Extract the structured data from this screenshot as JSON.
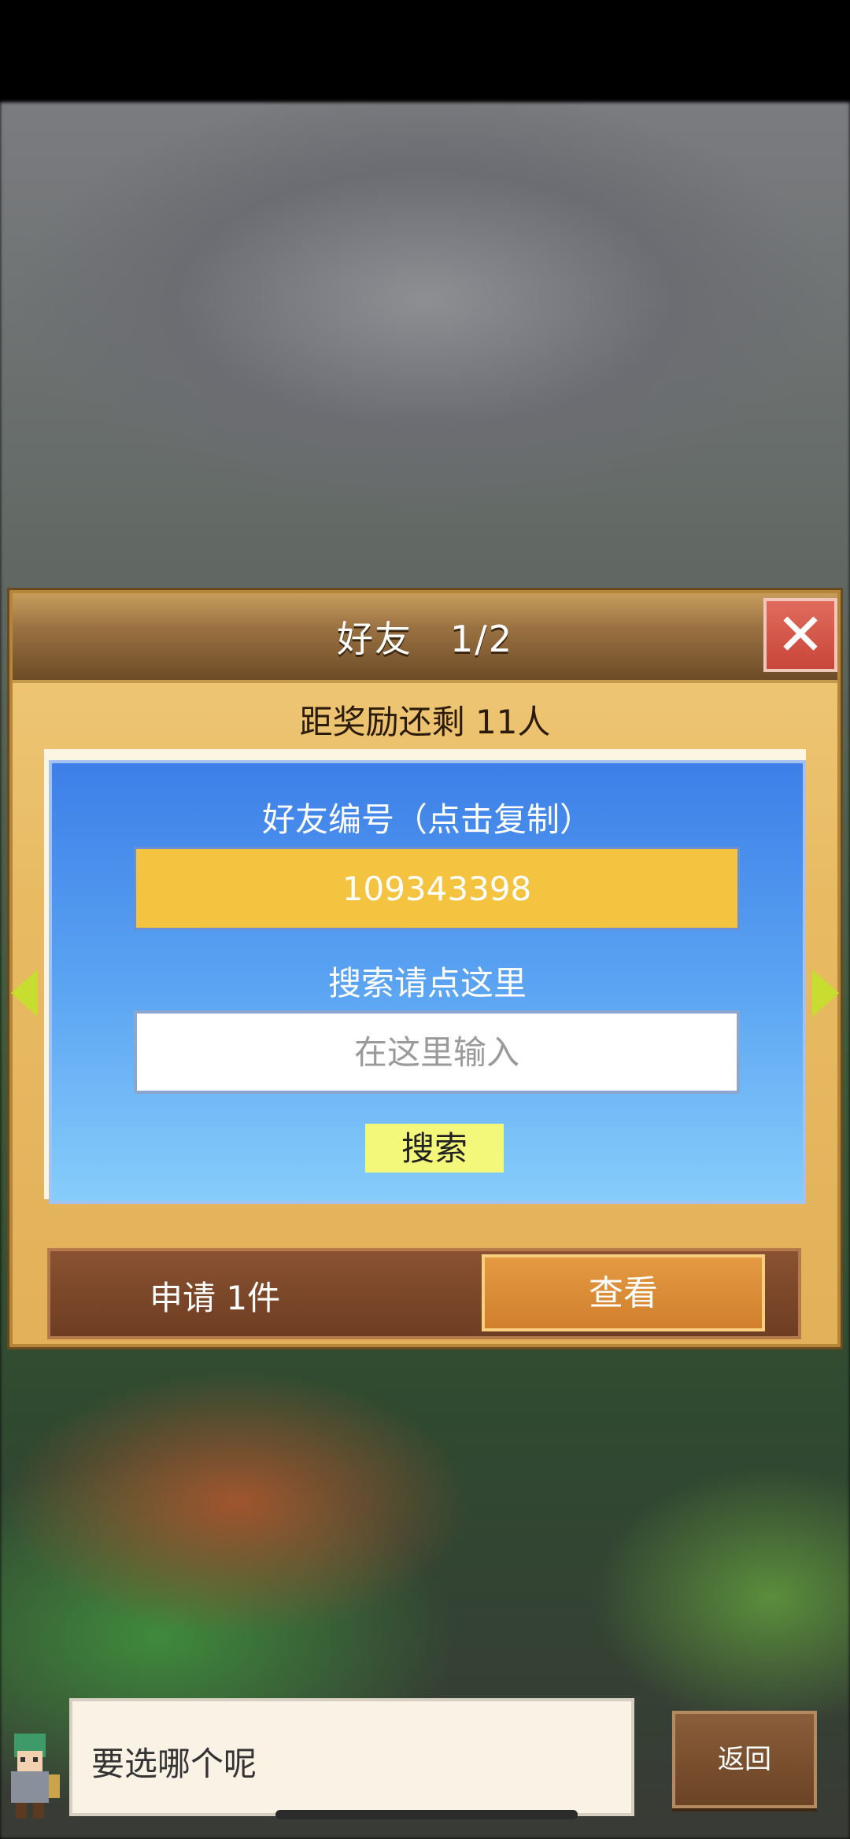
{
  "dialog": {
    "title": "好友　1/2",
    "close_icon": "close-icon",
    "reward_text": "距奖励还剩 11人"
  },
  "friend_panel": {
    "id_label": "好友编号（点击复制）",
    "friend_id": "109343398",
    "search_label": "搜索请点这里",
    "search_placeholder": "在这里输入",
    "search_button": "搜索"
  },
  "request_bar": {
    "request_text": "申请 1件",
    "view_button": "查看"
  },
  "chat": {
    "message": "要选哪个呢"
  },
  "back_button": "返回",
  "colors": {
    "header_brown": "#6d4b27",
    "panel_blue": "#3d7fe8",
    "id_box_yellow": "#f4c441",
    "search_button_yellow": "#f3f77a",
    "view_button_orange": "#d17f2c",
    "close_red": "#c8463a"
  }
}
